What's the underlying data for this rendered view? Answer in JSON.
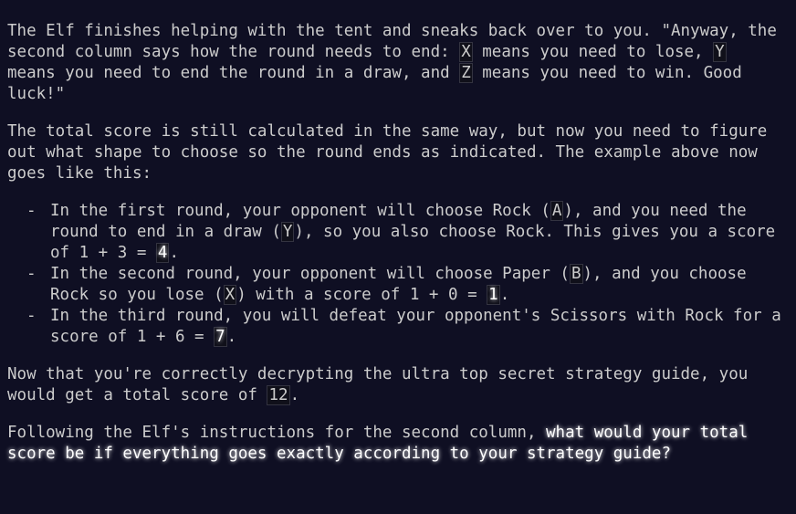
{
  "para1": {
    "text_a": "The Elf finishes helping with the tent and sneaks back over to you. \"Anyway, the second column says how the round needs to end: ",
    "code_x": "X",
    "text_b": " means you need to lose, ",
    "code_y": "Y",
    "text_c": " means you need to end the round in a draw, and ",
    "code_z": "Z",
    "text_d": " means you need to win. Good luck!\""
  },
  "para2": {
    "text": "The total score is still calculated in the same way, but now you need to figure out what shape to choose so the round ends as indicated. The example above now goes like this:"
  },
  "list": {
    "item1": {
      "text_a": "In the first round, your opponent will choose Rock (",
      "code_a": "A",
      "text_b": "), and you need the round to end in a draw (",
      "code_y": "Y",
      "text_c": "), so you also choose Rock. This gives you a score of 1 + 3 = ",
      "score": "4",
      "text_d": "."
    },
    "item2": {
      "text_a": "In the second round, your opponent will choose Paper (",
      "code_b": "B",
      "text_b": "), and you choose Rock so you lose (",
      "code_x": "X",
      "text_c": ") with a score of 1 + 0 = ",
      "score": "1",
      "text_d": "."
    },
    "item3": {
      "text_a": "In the third round, you will defeat your opponent's Scissors with Rock for a score of 1 + 6 = ",
      "score": "7",
      "text_b": "."
    }
  },
  "para3": {
    "text_a": "Now that you're correctly decrypting the ultra top secret strategy guide, you would get a total score of ",
    "total": "12",
    "text_b": "."
  },
  "para4": {
    "text_a": "Following the Elf's instructions for the second column, ",
    "question": "what would your total score be if everything goes exactly according to your strategy guide?"
  }
}
